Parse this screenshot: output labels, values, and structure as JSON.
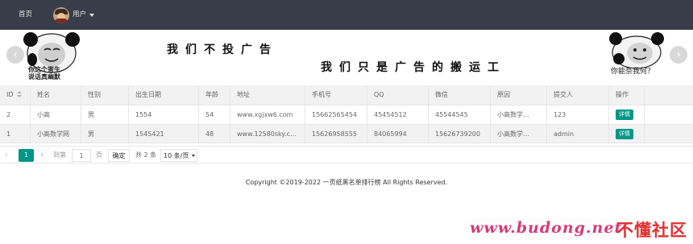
{
  "nav": {
    "home_label": "首页",
    "user_label": "用户"
  },
  "banner": {
    "meme_left_caption_line1": "你这个害生",
    "meme_left_caption_line2": "说话真幽默",
    "ad_text_1": "我们不投广告",
    "ad_text_2": "我们只是广告的搬运工",
    "meme_right_caption": "你能奈我何？"
  },
  "table": {
    "headers": [
      "ID",
      "姓名",
      "性别",
      "出生日期",
      "年龄",
      "地址",
      "手机号",
      "QQ",
      "微信",
      "原因",
      "提交人",
      "操作",
      ""
    ],
    "rows": [
      [
        "2",
        "小高",
        "男",
        "1554",
        "54",
        "www.xgjxw6.com",
        "15662565454",
        "45454512",
        "45544545",
        "小高数学…",
        "123",
        "详情"
      ],
      [
        "1",
        "小高数学网",
        "男",
        "1545421",
        "48",
        "www.12580sky.c…",
        "15626958555",
        "84065994",
        "15626739200",
        "小高数学…",
        "admin",
        "详情"
      ]
    ]
  },
  "pager": {
    "prev": "‹",
    "current_page": "1",
    "next": "›",
    "goto_label": "到第",
    "input_value": "1",
    "page_unit": "页",
    "confirm_label": "确定",
    "total_label": "共 2 条",
    "page_size": "10 条/页"
  },
  "footer": {
    "copyright": "Copyright ©2019-2022 一页纸黑名单排行榜 All Rights Reserved."
  },
  "watermark": {
    "url": "www.budong.net",
    "name": "不懂社区"
  }
}
